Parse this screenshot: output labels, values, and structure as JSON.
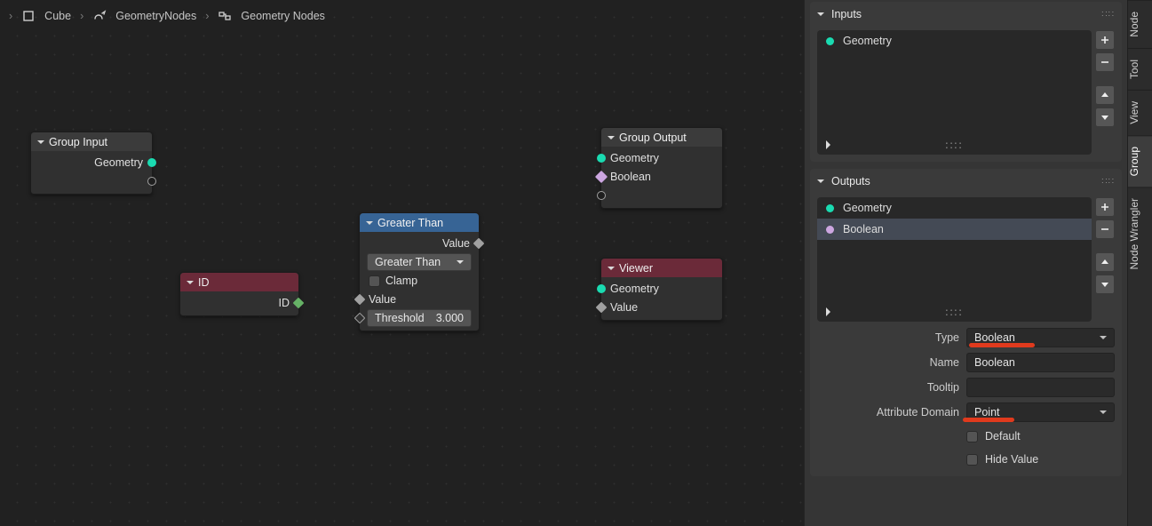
{
  "breadcrumb": {
    "object": "Cube",
    "modifier": "GeometryNodes",
    "tree": "Geometry Nodes"
  },
  "nodes": {
    "group_input": {
      "title": "Group Input",
      "out_geometry": "Geometry"
    },
    "id": {
      "title": "ID",
      "out_id": "ID"
    },
    "greater_than": {
      "title": "Greater Than",
      "mode": "Greater Than",
      "clamp_label": "Clamp",
      "out_value": "Value",
      "in_value": "Value",
      "threshold_label": "Threshold",
      "threshold_value": "3.000"
    },
    "group_output": {
      "title": "Group Output",
      "in_geometry": "Geometry",
      "in_boolean": "Boolean"
    },
    "viewer": {
      "title": "Viewer",
      "in_geometry": "Geometry",
      "in_value": "Value"
    }
  },
  "sidebar": {
    "inputs_title": "Inputs",
    "inputs": {
      "items": [
        {
          "label": "Geometry",
          "socket": "geometry"
        }
      ]
    },
    "outputs_title": "Outputs",
    "outputs": {
      "items": [
        {
          "label": "Geometry",
          "socket": "geometry"
        },
        {
          "label": "Boolean",
          "socket": "boolean"
        }
      ]
    },
    "form": {
      "type_label": "Type",
      "type_value": "Boolean",
      "name_label": "Name",
      "name_value": "Boolean",
      "tooltip_label": "Tooltip",
      "tooltip_value": "",
      "domain_label": "Attribute Domain",
      "domain_value": "Point",
      "default_label": "Default",
      "hide_label": "Hide Value"
    }
  },
  "tabs": {
    "node": "Node",
    "tool": "Tool",
    "view": "View",
    "group": "Group",
    "wrangler": "Node Wrangler"
  }
}
